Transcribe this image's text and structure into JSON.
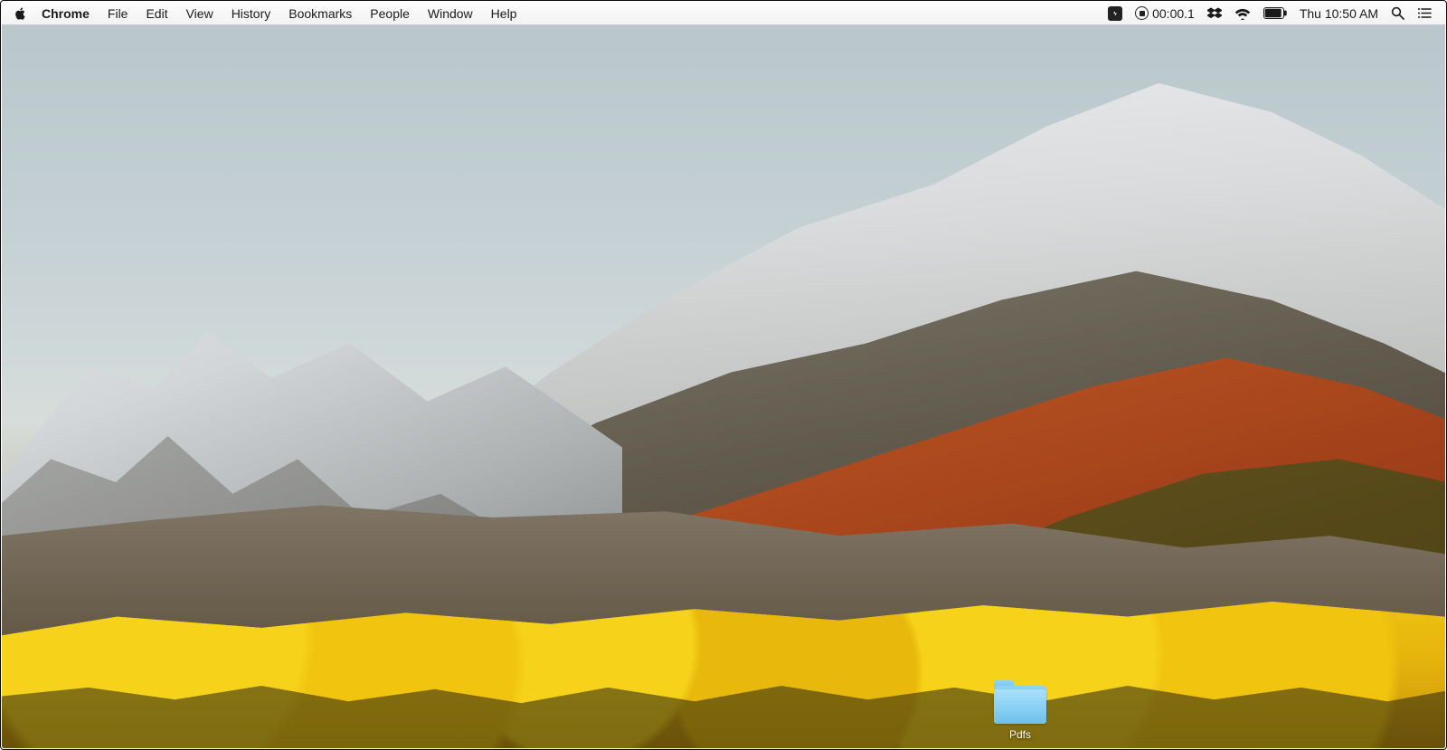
{
  "menubar": {
    "app_name": "Chrome",
    "items": [
      "File",
      "Edit",
      "View",
      "History",
      "Bookmarks",
      "People",
      "Window",
      "Help"
    ]
  },
  "status": {
    "recording_timer": "00:00.1",
    "clock": "Thu 10:50 AM"
  },
  "desktop": {
    "folder_label": "Pdfs"
  }
}
